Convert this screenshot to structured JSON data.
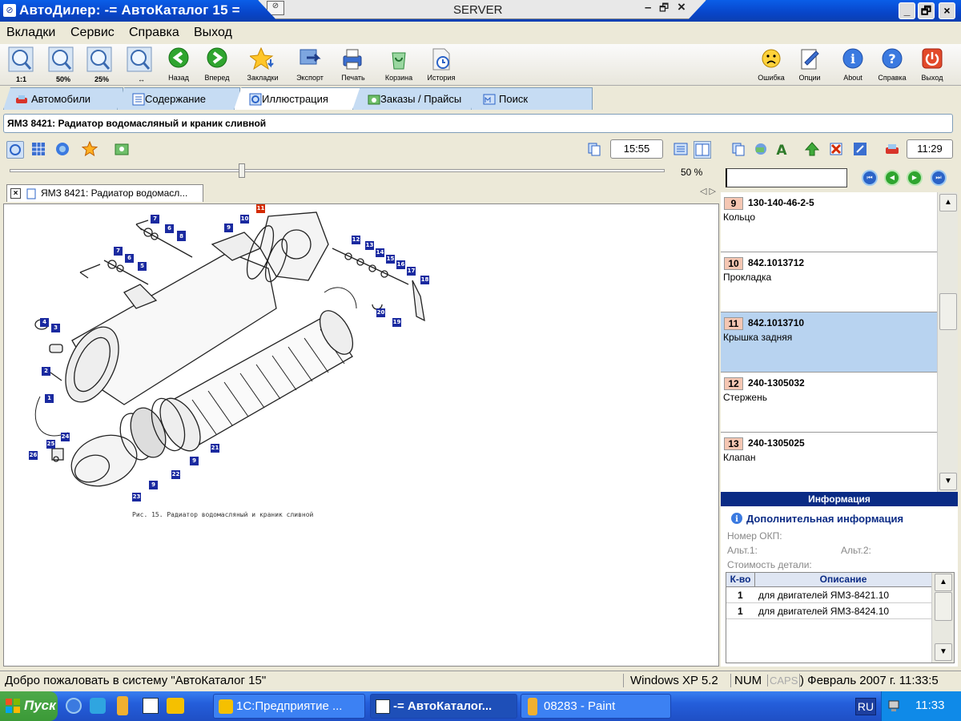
{
  "window": {
    "title": "АвтоДилер: -= АвтоКаталог 15 =",
    "rdp_title": "SERVER",
    "rdp_min": "–",
    "rdp_restore": "🗗",
    "rdp_close": "×"
  },
  "menu": [
    "Вкладки",
    "Сервис",
    "Справка",
    "Выход"
  ],
  "toolbar": {
    "zoom": [
      "1:1",
      "50%",
      "25%",
      "↔"
    ],
    "buttons": [
      "Назад",
      "Вперед",
      "Закладки",
      "Экспорт",
      "Печать",
      "Корзина",
      "История"
    ],
    "right_buttons": [
      "Ошибка",
      "Опции",
      "About",
      "Справка",
      "Выход"
    ]
  },
  "tabs": [
    "Автомобили",
    "Содержание",
    "Иллюстрация",
    "Заказы / Прайсы",
    "Поиск"
  ],
  "breadcrumb": "ЯМЗ 8421: Радиатор водомасляный и краник сливной",
  "viewer": {
    "time": "15:55",
    "zoom": "50 %",
    "zoom_level": 0.35,
    "doc_tab": "ЯМЗ 8421: Радиатор водомасл...",
    "caption": "Рис. 15. Радиатор водомасляный и краник сливной",
    "callouts": [
      "1",
      "2",
      "3",
      "4",
      "5",
      "6",
      "7",
      "5",
      "6",
      "7",
      "8",
      "9",
      "10",
      "11",
      "12",
      "13",
      "14",
      "15",
      "16",
      "17",
      "18",
      "19",
      "20",
      "21",
      "9",
      "22",
      "9",
      "23",
      "24",
      "25",
      "26"
    ]
  },
  "right": {
    "time": "11:29",
    "search_value": "",
    "parts": [
      {
        "num": "9",
        "code": "130-140-46-2-5",
        "name": "Кольцо"
      },
      {
        "num": "10",
        "code": "842.1013712",
        "name": "Прокладка"
      },
      {
        "num": "11",
        "code": "842.1013710",
        "name": "Крышка задняя"
      },
      {
        "num": "12",
        "code": "240-1305032",
        "name": "Стержень"
      },
      {
        "num": "13",
        "code": "240-1305025",
        "name": "Клапан"
      }
    ],
    "info_header": "Информация",
    "info_title": "Дополнительная информация",
    "okp_label": "Номер ОКП:",
    "alt1_label": "Альт.1:",
    "alt2_label": "Альт.2:",
    "cost_label": "Стоимость детали:",
    "table": {
      "headers": [
        "К-во",
        "Описание"
      ],
      "rows": [
        {
          "qty": "1",
          "desc": "для двигателей ЯМЗ-8421.10"
        },
        {
          "qty": "1",
          "desc": "для двигателей ЯМЗ-8424.10"
        }
      ]
    }
  },
  "status": {
    "message": "Добро пожаловать в систему \"АвтоКаталог 15\"",
    "os": "Windows XP 5.2",
    "num": "NUM",
    "caps": "CAPS",
    "date": ") Февраль 2007 г. 11:33:5"
  },
  "taskbar": {
    "start": "Пуск",
    "tasks": [
      "1С:Предприятие ...",
      "-= АвтоКаталог...",
      "08283 - Paint"
    ],
    "lang": "RU",
    "clock": "11:33"
  }
}
